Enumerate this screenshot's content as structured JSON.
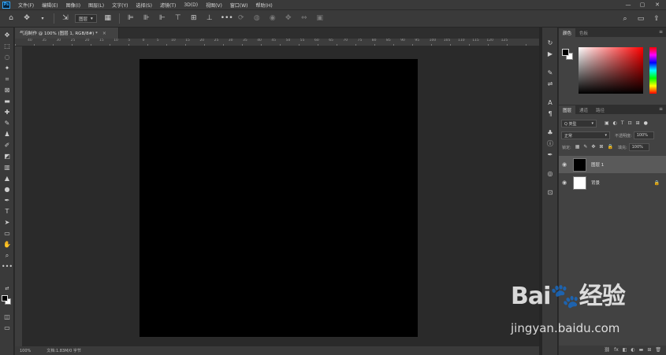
{
  "app": {
    "logo_text": "Ps",
    "menu": [
      "文件(F)",
      "编辑(E)",
      "图像(I)",
      "图层(L)",
      "文字(Y)",
      "选择(S)",
      "滤镜(T)",
      "3D(D)",
      "视图(V)",
      "窗口(W)",
      "帮助(H)"
    ],
    "window_controls": {
      "minimize": "—",
      "maximize": "▢",
      "close": "✕"
    }
  },
  "options_bar": {
    "home_icon": "⌂",
    "move_tool_icon": "✥",
    "auto_select_label": "图层",
    "search_icon": "⌕",
    "workspace_icon": "▭",
    "share_icon": "⇪"
  },
  "document": {
    "tab_title": "气泡制作 @ 100% (图层 1, RGB/8#) *",
    "tab_close": "×",
    "zoom": "100%",
    "doc_info": "文档:1.83M/0 字节",
    "canvas_color": "#000000",
    "ruler_numbers": [
      "40",
      "35",
      "30",
      "25",
      "20",
      "15",
      "10",
      "5",
      "0",
      "5",
      "10",
      "15",
      "20",
      "25",
      "30",
      "35",
      "40",
      "45",
      "50",
      "55",
      "60",
      "65",
      "70",
      "75",
      "80",
      "85",
      "90",
      "95",
      "100",
      "105",
      "110",
      "115",
      "120",
      "125"
    ]
  },
  "panels": {
    "color": {
      "tabs": [
        "颜色",
        "色板"
      ],
      "active_tab": 0,
      "menu_icon": "≡",
      "foreground": "#000000",
      "background": "#ffffff"
    },
    "layers": {
      "tabs": [
        "图层",
        "通道",
        "路径"
      ],
      "active_tab": 0,
      "menu_icon": "≡",
      "filter_kind": "Q 类型",
      "blend_mode": "正常",
      "opacity_label": "不透明度:",
      "opacity_value": "100%",
      "lock_label": "锁定:",
      "fill_label": "填充:",
      "fill_value": "100%",
      "items": [
        {
          "name": "图层 1",
          "thumb": "#000000",
          "visible_icon": "◉",
          "selected": true,
          "locked_icon": ""
        },
        {
          "name": "背景",
          "thumb": "#ffffff",
          "visible_icon": "◉",
          "selected": false,
          "locked_icon": "🔒"
        }
      ],
      "footer_icons": [
        "⛓",
        "fx",
        "◧",
        "◐",
        "▬",
        "⊞",
        "🗑"
      ]
    }
  },
  "watermark": {
    "logo": "Bai🐾经验",
    "url": "jingyan.baidu.com"
  }
}
